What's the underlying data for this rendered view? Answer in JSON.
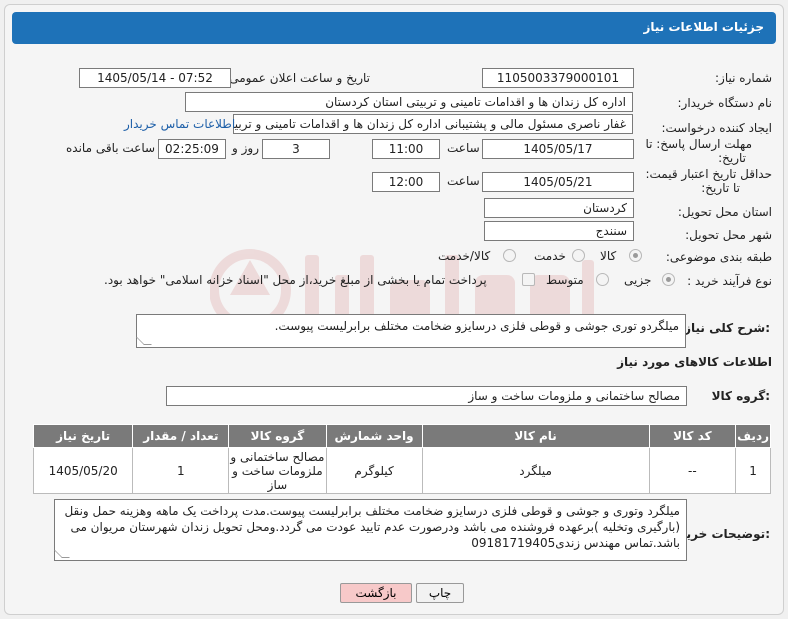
{
  "header": {
    "title": "جزئیات اطلاعات نیاز"
  },
  "fields": {
    "need_number": {
      "label": "شماره نیاز:",
      "value": "1105003379000101"
    },
    "announce_datetime": {
      "label": "تاریخ و ساعت اعلان عمومی:",
      "value": "1405/05/14 - 07:52"
    },
    "buyer_org": {
      "label": "نام دستگاه خریدار:",
      "value": "اداره کل زندان ها و اقدامات تامینی و تربیتی استان کردستان"
    },
    "requester": {
      "label": "ایجاد کننده درخواست:",
      "value": "غفار ناصری مسئول مالی و پشتیبانی اداره کل زندان ها و اقدامات تامینی و تربیتی",
      "link": "اطلاعات تماس خریدار"
    },
    "reply_deadline": {
      "label": "مهلت ارسال پاسخ: تا تاریخ:",
      "date": "1405/05/17",
      "time_label": "ساعت",
      "time": "11:00",
      "days": "3",
      "days_label": "روز و",
      "remaining": "02:25:09",
      "remaining_label": "ساعت باقی مانده"
    },
    "price_validity": {
      "label": "حداقل تاریخ اعتبار قیمت: تا تاریخ:",
      "date": "1405/05/21",
      "time_label": "ساعت",
      "time": "12:00"
    },
    "delivery_province": {
      "label": "استان محل تحویل:",
      "value": "کردستان"
    },
    "delivery_city": {
      "label": "شهر محل تحویل:",
      "value": "سنندج"
    },
    "category": {
      "label": "طبقه بندی موضوعی:",
      "options": [
        "کالا",
        "خدمت",
        "کالا/خدمت"
      ],
      "selected": "کالا"
    },
    "process": {
      "label": "نوع فرآیند خرید :",
      "options": [
        "جزیی",
        "متوسط"
      ],
      "selected": "جزیی",
      "payment_note": "پرداخت تمام یا بخشی از مبلغ خرید،از محل \"اسناد خزانه اسلامی\" خواهد بود."
    }
  },
  "description": {
    "label": "شرح کلی نیاز:",
    "value": "میلگردو توری جوشی و قوطی فلزی درسایزو ضخامت مختلف برابرلیست پیوست."
  },
  "goods_info": {
    "title": "اطلاعات کالاهای مورد نیاز",
    "group_label": "گروه کالا:",
    "group_value": "مصالح ساختمانی و ملزومات ساخت و ساز"
  },
  "table": {
    "headers": [
      "ردیف",
      "کد کالا",
      "نام کالا",
      "واحد شمارش",
      "گروه کالا",
      "تعداد / مقدار",
      "تاریخ نیاز"
    ],
    "rows": [
      [
        "1",
        "--",
        "میلگرد",
        "کیلوگرم",
        "مصالح ساختمانی و ملزومات ساخت و ساز",
        "1",
        "1405/05/20"
      ]
    ]
  },
  "buyer_notes": {
    "label": "توضیحات خریدار:",
    "value": "میلگرد وتوری و جوشی و قوطی فلزی درسایزو ضخامت مختلف برابرلیست پیوست.مدت پرداخت یک ماهه وهزینه حمل ونقل (بارگیری وتخلیه )برعهده فروشنده می باشد ودرصورت عدم تایید عودت می گردد.ومحل تحویل زندان شهرستان مریوان می باشد.تماس مهندس زندی09181719405"
  },
  "buttons": {
    "print": "چاپ",
    "back": "بازگشت"
  },
  "colors": {
    "header": "#1e72b8",
    "table_header": "#7a7a7a",
    "back_button": "#f7c9c9",
    "link": "#1d5fa8"
  }
}
